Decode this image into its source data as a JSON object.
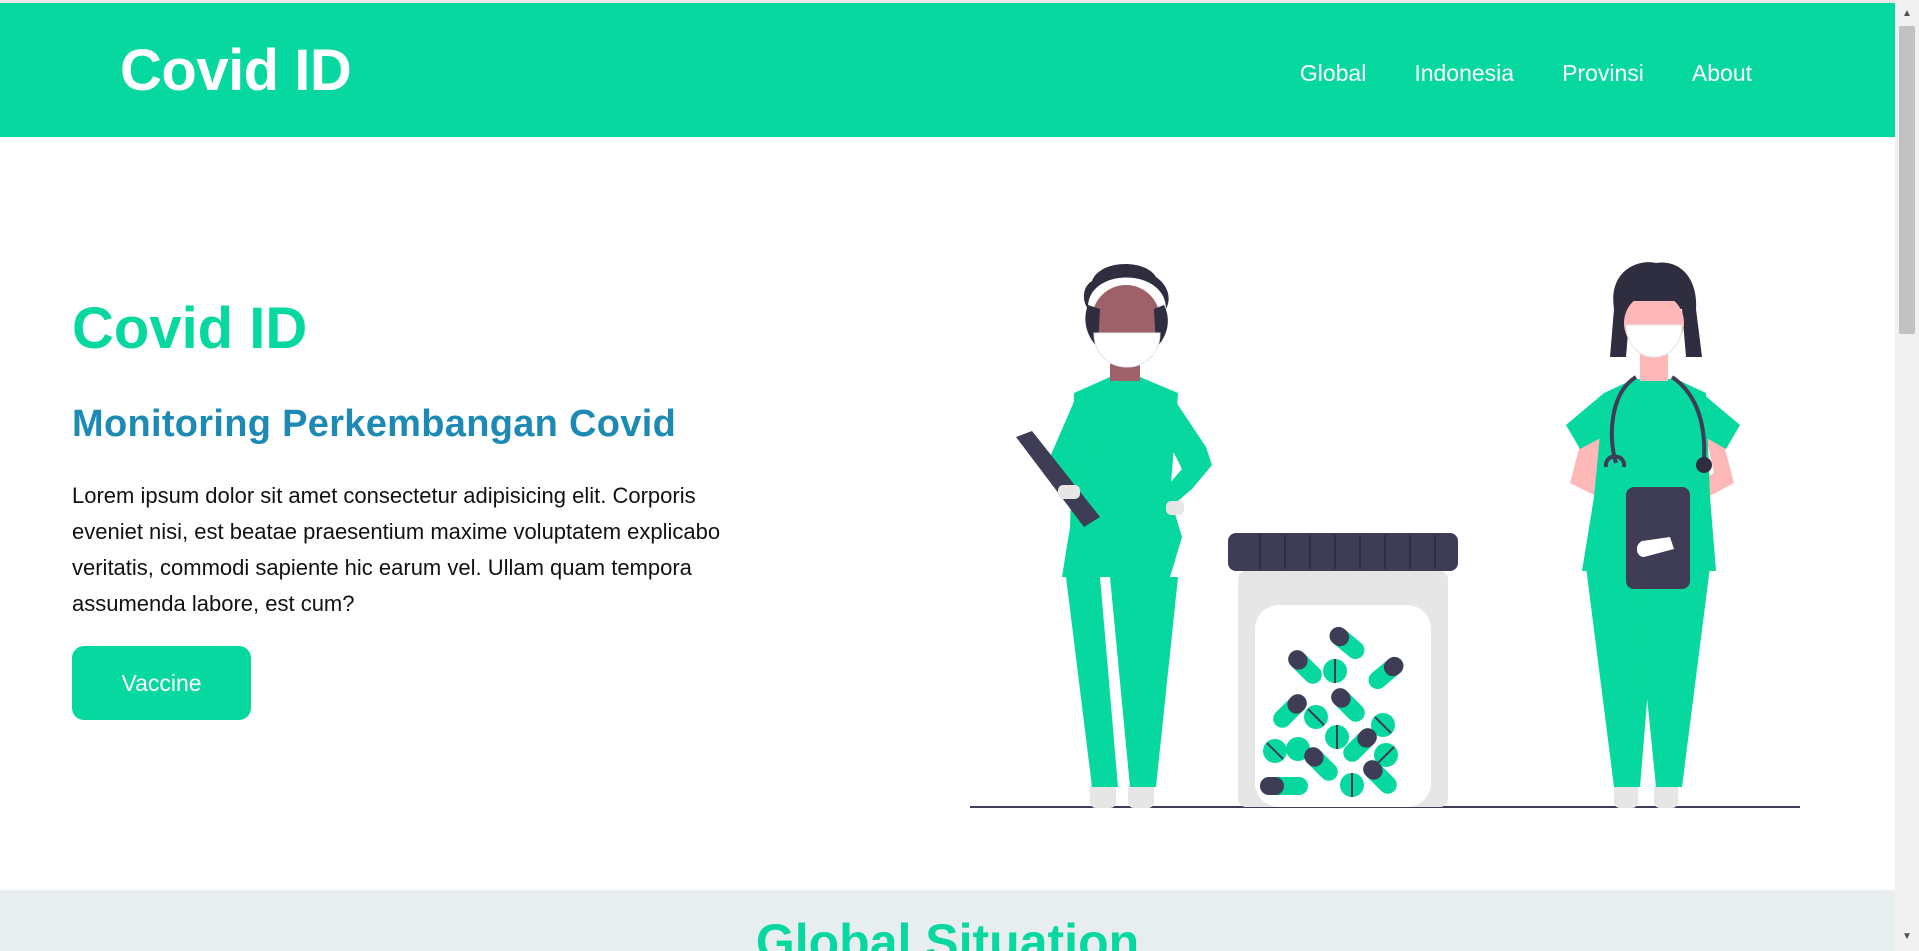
{
  "navbar": {
    "brand": "Covid ID",
    "links": [
      "Global",
      "Indonesia",
      "Provinsi",
      "About"
    ]
  },
  "hero": {
    "title": "Covid ID",
    "subtitle": "Monitoring Perkembangan Covid",
    "description": "Lorem ipsum dolor sit amet consectetur adipisicing elit. Corporis eveniet nisi, est beatae praesentium maxime voluptatem explicabo veritatis, commodi sapiente hic earum vel. Ullam quam tempora assumenda labore, est cum?",
    "button_label": "Vaccine",
    "illustration": "doctors-with-medicine-jar"
  },
  "global": {
    "title": "Global Situation"
  },
  "scrollbar": {
    "up_arrow": "▲",
    "down_arrow": "▼"
  },
  "colors": {
    "accent": "#07d89f",
    "subtitle": "#1d8ab5",
    "dark": "#3f3d56",
    "section_bg": "#e8edf0"
  }
}
